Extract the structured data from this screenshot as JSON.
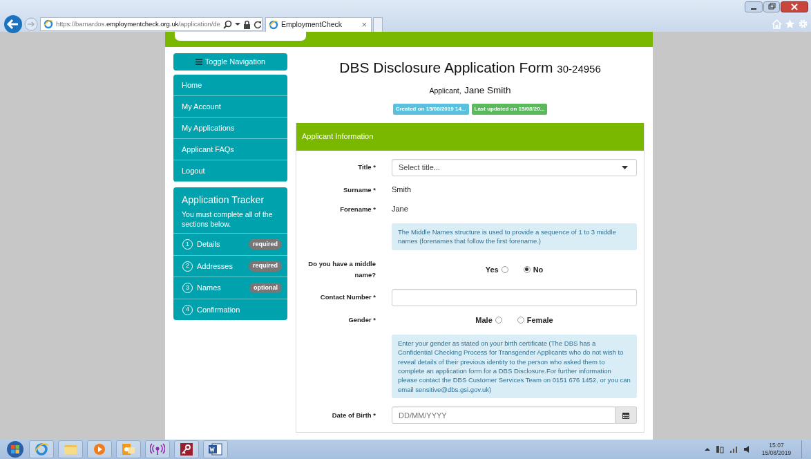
{
  "browser": {
    "url": {
      "scheme": "https://",
      "subdomain": "barnardos.",
      "domain": "employmentcheck.org.uk",
      "path": "/application/de"
    },
    "tab": {
      "title": "EmploymentCheck",
      "close": "×"
    }
  },
  "sidebar": {
    "toggle": "Toggle Navigation",
    "nav": [
      {
        "label": "Home"
      },
      {
        "label": "My Account"
      },
      {
        "label": "My Applications"
      },
      {
        "label": "Applicant FAQs"
      },
      {
        "label": "Logout"
      }
    ],
    "tracker": {
      "title": "Application Tracker",
      "note": "You must complete all of the sections below.",
      "steps": [
        {
          "number": "1",
          "label": "Details",
          "badge": "required"
        },
        {
          "number": "2",
          "label": "Addresses",
          "badge": "required"
        },
        {
          "number": "3",
          "label": "Names",
          "badge": "optional"
        },
        {
          "number": "4",
          "label": "Confirmation"
        }
      ]
    }
  },
  "header": {
    "title": "DBS Disclosure Application Form",
    "reference": "30-24956",
    "applicant_label": "Applicant,",
    "applicant_name": "Jane Smith",
    "badges": [
      {
        "text": "Created on 15/08/2019 14...",
        "color": "#5bc0de"
      },
      {
        "text": "Last updated on 15/08/20...",
        "color": "#5cb85c"
      }
    ]
  },
  "panel": {
    "title": "Applicant Information",
    "fields": [
      {
        "kind": "select",
        "label": "Title *",
        "placeholder": "Select title..."
      },
      {
        "kind": "static",
        "label": "Surname *",
        "value": "Smith"
      },
      {
        "kind": "static",
        "label": "Forename *",
        "value": "Jane"
      },
      {
        "kind": "info",
        "text": "The Middle Names structure is used to provide a sequence of 1 to 3 middle names (forenames that follow the first forename.)"
      },
      {
        "kind": "radio",
        "label": "Do you have a middle name?",
        "options": [
          {
            "label": "Yes",
            "selected": false
          },
          {
            "label": "No",
            "selected": true
          }
        ]
      },
      {
        "kind": "input",
        "label": "Contact Number *"
      },
      {
        "kind": "radio",
        "label": "Gender *",
        "options": [
          {
            "label": "Male",
            "selected": false
          },
          {
            "label": "Female",
            "selected": false
          }
        ]
      },
      {
        "kind": "info",
        "text": "Enter your gender as stated on your birth certificate (The DBS has a Confidential Checking Process for Transgender Applicants who do not wish to reveal details of their previous identity to the person who asked them to complete an application form for a DBS Disclosure.For further information please contact the DBS Customer Services Team on 0151 676 1452, or you can email sensitive@dbs.gsi.gov.uk)"
      },
      {
        "kind": "date",
        "label": "Date of Birth *",
        "placeholder": "DD/MM/YYYY"
      }
    ]
  },
  "taskbar": {
    "time": "15:07",
    "date": "15/08/2019"
  }
}
